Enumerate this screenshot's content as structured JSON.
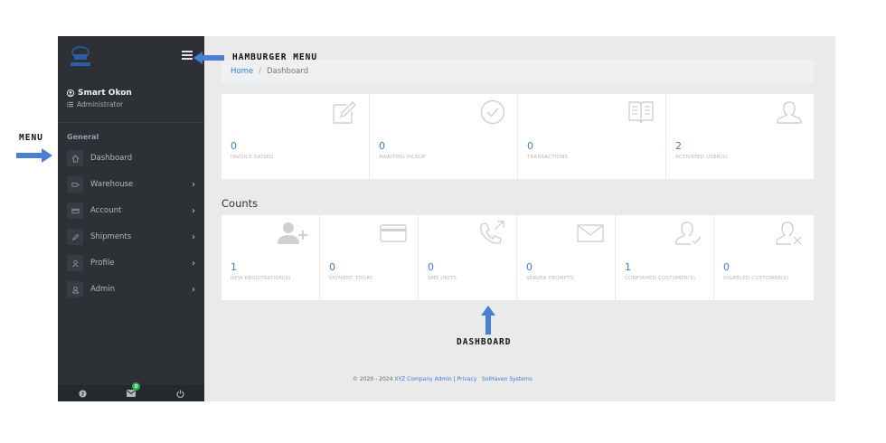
{
  "sidebar": {
    "user_name": "Smart Okon",
    "user_role": "Administrator",
    "section_label": "General",
    "items": [
      {
        "label": "Dashboard",
        "icon": "home-icon",
        "has_submenu": false
      },
      {
        "label": "Warehouse",
        "icon": "warehouse-icon",
        "has_submenu": true
      },
      {
        "label": "Account",
        "icon": "card-icon",
        "has_submenu": true
      },
      {
        "label": "Shipments",
        "icon": "pen-icon",
        "has_submenu": true
      },
      {
        "label": "Profile",
        "icon": "profile-icon",
        "has_submenu": true
      },
      {
        "label": "Admin",
        "icon": "user-icon",
        "has_submenu": true
      }
    ],
    "footer": {
      "help_icon": "help-icon",
      "mail_icon": "mail-icon",
      "mail_badge": "0",
      "power_icon": "power-icon",
      "badge_color": "#29b34a"
    }
  },
  "breadcrumb": {
    "home": "Home",
    "separator": "/",
    "current": "Dashboard"
  },
  "stats": [
    {
      "value": "0",
      "label": "INVOICE RAISED",
      "icon": "edit-icon"
    },
    {
      "value": "0",
      "label": "AWAITING PICKUP",
      "icon": "check-circle-icon"
    },
    {
      "value": "0",
      "label": "TRANSACTIONS",
      "icon": "book-icon"
    },
    {
      "value": "2",
      "label": "ACTIVATED USER(S)",
      "icon": "user-outline-icon"
    }
  ],
  "counts": {
    "title": "Counts",
    "cards": [
      {
        "value": "1",
        "label": "NEW REGISTRATION(S)",
        "icon": "user-plus-icon"
      },
      {
        "value": "0",
        "label": "PAYMENT TODAY",
        "icon": "credit-card-icon"
      },
      {
        "value": "0",
        "label": "SMS UNITS",
        "icon": "phone-outgoing-icon"
      },
      {
        "value": "0",
        "label": "SERVER PROMPTS",
        "icon": "envelope-icon"
      },
      {
        "value": "1",
        "label": "CONFIRMED CUSTOMER(S)",
        "icon": "user-check-icon"
      },
      {
        "value": "0",
        "label": "DISABLED CUSTOMER(S)",
        "icon": "user-x-icon"
      }
    ]
  },
  "footer": {
    "prefix": "© 2020 - 2024 ",
    "company": "XYZ Company Admin",
    "divider": " | ",
    "privacy": "Privacy",
    "partner": "SolHaven Systems"
  },
  "annotations": {
    "hamburger": "HAMBURGER MENU",
    "menu": "MENU",
    "dashboard": "DASHBOARD",
    "arrow_color": "#4a7fd4"
  },
  "colors": {
    "sidebar_bg": "#2d3035",
    "link_blue": "#3b7dd8",
    "content_bg": "#eaeaea"
  }
}
